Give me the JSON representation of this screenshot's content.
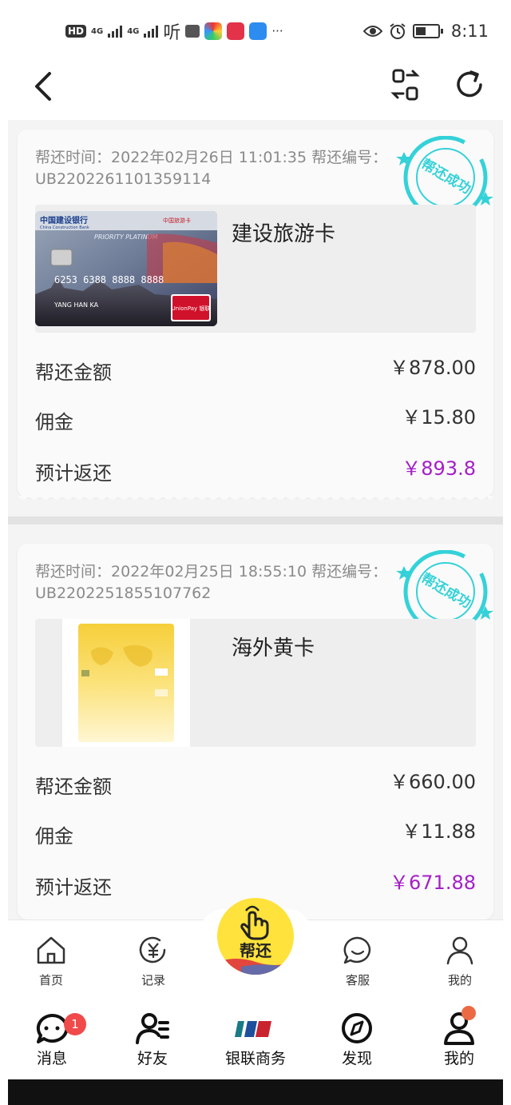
{
  "status_bar": {
    "hd": "HD",
    "net1": "4G",
    "net2": "4G",
    "ting": "听",
    "more": "···",
    "time": "8:11"
  },
  "header": {
    "back_icon": "chevron-left-icon",
    "switch_icon": "switch-view-icon",
    "refresh_icon": "refresh-icon"
  },
  "records": [
    {
      "time_label": "帮还时间：",
      "time": "2022年02月26日 11:01:35",
      "no_label": "帮还编号：",
      "no": "UB2202261101359114",
      "stamp_text": "帮还成功",
      "card_name": "建设旅游卡",
      "card_image": {
        "bank": "中国建设银行",
        "bank_en": "China Construction Bank",
        "tag": "中国旅游卡",
        "tier": "PRIORITY PLATINUM",
        "number": "6253 6388 8888 8888",
        "holder": "YANG HAN KA",
        "network": "UnionPay 银联"
      },
      "amount_label": "帮还金额",
      "amount": "￥878.00",
      "fee_label": "佣金",
      "fee": "￥15.80",
      "return_label": "预计返还",
      "return": "￥893.8"
    },
    {
      "time_label": "帮还时间：",
      "time": "2022年02月25日 18:55:10",
      "no_label": "帮还编号：",
      "no": "UB2202251855107762",
      "stamp_text": "帮还成功",
      "card_name": "海外黄卡",
      "amount_label": "帮还金额",
      "amount": "￥660.00",
      "fee_label": "佣金",
      "fee": "￥11.88",
      "return_label": "预计返还",
      "return": "￥671.88"
    }
  ],
  "app_tabs": [
    {
      "label": "首页",
      "icon": "home-icon"
    },
    {
      "label": "记录",
      "icon": "yuan-record-icon"
    },
    {
      "label": "帮还",
      "icon": "tap-hand-icon"
    },
    {
      "label": "客服",
      "icon": "chat-bubble-icon"
    },
    {
      "label": "我的",
      "icon": "user-icon"
    }
  ],
  "host_tabs": [
    {
      "label": "消息",
      "icon": "message-icon",
      "badge": "1"
    },
    {
      "label": "好友",
      "icon": "friends-icon"
    },
    {
      "label": "银联商务",
      "icon": "unionpay-logo"
    },
    {
      "label": "发现",
      "icon": "compass-icon"
    },
    {
      "label": "我的",
      "icon": "profile-icon"
    }
  ],
  "colors": {
    "accent_purple": "#a51fc7",
    "stamp_cyan": "#34d2d8",
    "center_yellow": "#ffe23b",
    "badge_red": "#f04a4a"
  }
}
